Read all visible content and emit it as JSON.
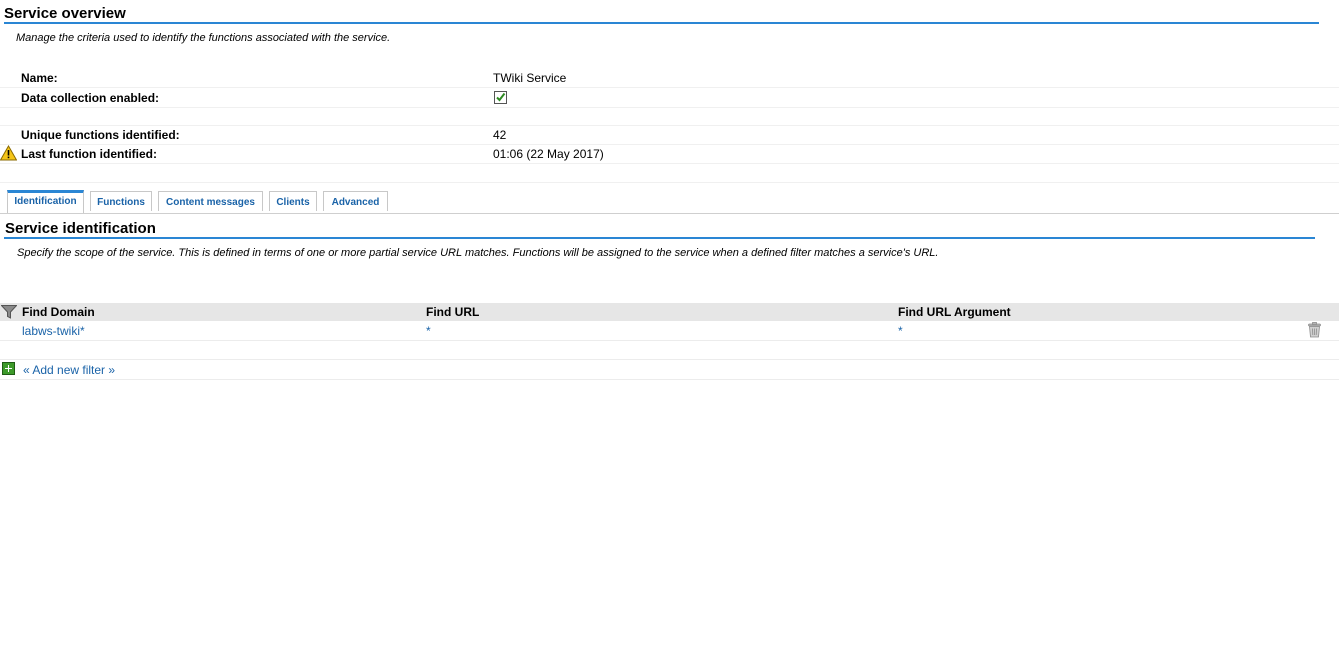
{
  "overview": {
    "title": "Service overview",
    "description": "Manage the criteria used to identify the functions associated with the service.",
    "props": {
      "name_label": "Name:",
      "name_value": "TWiki Service",
      "collection_label": "Data collection enabled:",
      "collection_enabled": true,
      "unique_label": "Unique functions identified:",
      "unique_value": "42",
      "last_label": "Last function identified:",
      "last_value": "01:06 (22 May 2017)"
    }
  },
  "tabs": [
    {
      "label": "Identification",
      "active": true
    },
    {
      "label": "Functions",
      "active": false
    },
    {
      "label": "Content messages",
      "active": false
    },
    {
      "label": "Clients",
      "active": false
    },
    {
      "label": "Advanced",
      "active": false
    }
  ],
  "identification": {
    "title": "Service identification",
    "description": "Specify the scope of the service. This is defined in terms of one or more partial service URL matches. Functions will be assigned to the service when a defined filter matches a service's URL.",
    "columns": {
      "domain": "Find Domain",
      "url": "Find URL",
      "argument": "Find URL Argument"
    },
    "rows": [
      {
        "domain": "labws-twiki*",
        "url": "*",
        "argument": "*"
      }
    ],
    "add_filter_label": "« Add new filter »"
  },
  "icons": {
    "warning": "warning-icon",
    "checkbox": "checkbox-checked-icon",
    "filter": "funnel-filter-icon",
    "delete": "trash-icon",
    "add": "plus-add-icon"
  },
  "colors": {
    "accent": "#2a86d4",
    "link": "#1a63a8",
    "header_bg": "#e6e6e6"
  }
}
